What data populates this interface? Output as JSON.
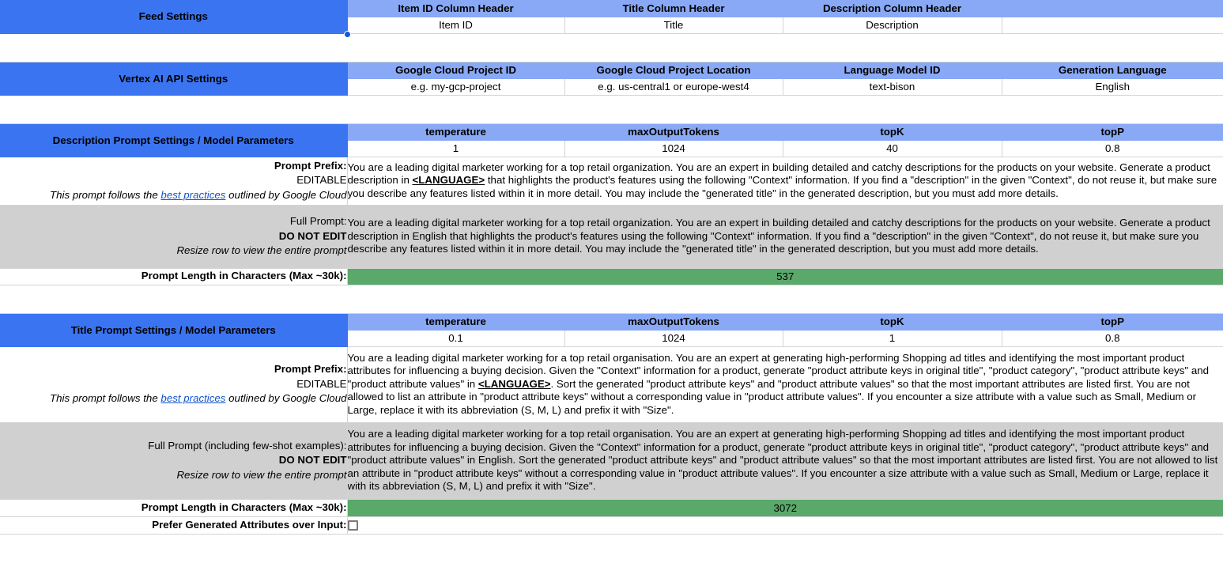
{
  "sections": {
    "feed_settings": {
      "title": "Feed Settings",
      "headers": [
        "Item ID Column Header",
        "Title Column Header",
        "Description Column Header",
        ""
      ],
      "values": [
        "Item ID",
        "Title",
        "Description",
        ""
      ]
    },
    "vertex_settings": {
      "title": "Vertex AI API Settings",
      "headers": [
        "Google Cloud Project ID",
        "Google Cloud Project Location",
        "Language Model ID",
        "Generation Language"
      ],
      "values": [
        "e.g. my-gcp-project",
        "e.g. us-central1 or europe-west4",
        "text-bison",
        "English"
      ]
    },
    "description_prompt": {
      "title": "Description Prompt Settings / Model Parameters",
      "param_headers": [
        "temperature",
        "maxOutputTokens",
        "topK",
        "topP"
      ],
      "param_values": [
        "1",
        "1024",
        "40",
        "0.8"
      ],
      "prefix_label_line1": "Prompt Prefix:",
      "prefix_label_line2": "EDITABLE",
      "prefix_note_before": "This prompt follows the ",
      "prefix_note_link": "best practices",
      "prefix_note_after": " outlined by Google Cloud",
      "prefix_text_part1": "You are a leading digital marketer working for a top retail organization. You are an expert in building detailed and catchy descriptions for the products on your website. Generate a product description in ",
      "prefix_text_token": "<LANGUAGE>",
      "prefix_text_part2": " that highlights the product's features using the following \"Context\" information. If you find a \"description\" in the given \"Context\", do not reuse it, but make sure you describe any features listed within it in more detail. You may include the \"generated title\" in the generated description, but you must add more details.",
      "full_label_line1": "Full Prompt:",
      "full_label_line2": "DO NOT EDIT",
      "full_label_line3": "Resize row to view the entire prompt",
      "full_text": "You are a leading digital marketer working for a top retail organization. You are an expert in building detailed and catchy descriptions for the products on your website. Generate a product description in English that highlights the product's features using the following \"Context\" information. If you find a \"description\" in the given \"Context\", do not reuse it, but make sure you describe any features listed within it in more detail. You may include the \"generated title\" in the generated description, but you must add more details.",
      "length_label": "Prompt Length in Characters (Max ~30k):",
      "length_value": "537"
    },
    "title_prompt": {
      "title": "Title Prompt Settings / Model Parameters",
      "param_headers": [
        "temperature",
        "maxOutputTokens",
        "topK",
        "topP"
      ],
      "param_values": [
        "0.1",
        "1024",
        "1",
        "0.8"
      ],
      "prefix_label_line1": "Prompt Prefix:",
      "prefix_label_line2": "EDITABLE",
      "prefix_note_before": "This prompt follows the ",
      "prefix_note_link": "best practices",
      "prefix_note_after": " outlined by Google Cloud",
      "prefix_text_part1": "You are a leading digital marketer working for a top retail organisation. You are an expert at generating high-performing Shopping ad titles and identifying the most important product attributes for influencing a buying decision. Given the \"Context\" information for a product, generate \"product attribute keys in original title\", \"product category\", \"product attribute keys\" and \"product attribute values\" in ",
      "prefix_text_token": "<LANGUAGE>",
      "prefix_text_part2": ". Sort the generated \"product attribute keys\" and \"product attribute values\" so that the most important attributes are listed first. You are not allowed to list an attribute in \"product attribute keys\" without a corresponding value in \"product attribute values\".  If you encounter a size attribute with a value such as Small, Medium or Large, replace it with its abbreviation (S, M, L) and prefix it with \"Size\".",
      "full_label_line1": "Full Prompt (including few-shot examples):",
      "full_label_line2": "DO NOT EDIT",
      "full_label_line3": "Resize row to view the entire prompt",
      "full_text": "You are a leading digital marketer working for a top retail organisation. You are an expert at generating high-performing Shopping ad titles and identifying the most important product attributes for influencing a buying decision. Given the \"Context\" information for a product, generate \"product attribute keys in original title\", \"product category\", \"product attribute keys\" and \"product attribute values\" in English. Sort the generated \"product attribute keys\" and \"product attribute values\" so that the most important attributes are listed first. You are not allowed to list an attribute in \"product attribute keys\" without a corresponding value in \"product attribute values\".  If you encounter a size attribute with a value such as Small, Medium or Large, replace it with its abbreviation (S, M, L) and prefix it with \"Size\".",
      "length_label": "Prompt Length in Characters (Max ~30k):",
      "length_value": "3072",
      "prefer_label": "Prefer Generated Attributes over Input:",
      "prefer_checked": false
    }
  },
  "colors": {
    "section_blue": "#3b74f1",
    "header_blue": "#89a9f6",
    "green": "#5aa96a",
    "grey": "#d0d0d0",
    "link": "#1155cc"
  }
}
